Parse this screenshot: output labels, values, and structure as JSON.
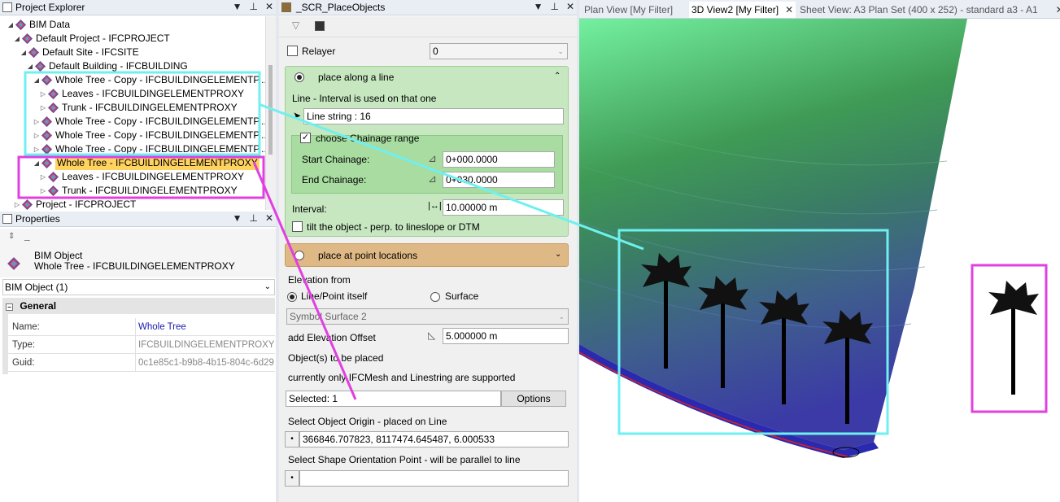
{
  "explorer": {
    "title": "Project Explorer",
    "tree": [
      {
        "label": "BIM Data",
        "indent": 0,
        "twisty": "expanded"
      },
      {
        "label": "Default Project - IFCPROJECT",
        "indent": 1,
        "twisty": "expanded"
      },
      {
        "label": "Default Site - IFCSITE",
        "indent": 2,
        "twisty": "expanded"
      },
      {
        "label": "Default Building - IFCBUILDING",
        "indent": 3,
        "twisty": "expanded"
      },
      {
        "label": "Whole Tree - Copy - IFCBUILDINGELEMENTP...",
        "indent": 4,
        "twisty": "expanded"
      },
      {
        "label": "Leaves - IFCBUILDINGELEMENTPROXY",
        "indent": 5,
        "twisty": "collapsed"
      },
      {
        "label": "Trunk - IFCBUILDINGELEMENTPROXY",
        "indent": 5,
        "twisty": "collapsed"
      },
      {
        "label": "Whole Tree - Copy - IFCBUILDINGELEMENTP...",
        "indent": 4,
        "twisty": "collapsed"
      },
      {
        "label": "Whole Tree - Copy - IFCBUILDINGELEMENTP...",
        "indent": 4,
        "twisty": "collapsed"
      },
      {
        "label": "Whole Tree - Copy - IFCBUILDINGELEMENTP...",
        "indent": 4,
        "twisty": "collapsed"
      },
      {
        "label": "Whole Tree - IFCBUILDINGELEMENTPROXY",
        "indent": 4,
        "twisty": "expanded",
        "selected": true
      },
      {
        "label": "Leaves - IFCBUILDINGELEMENTPROXY",
        "indent": 5,
        "twisty": "collapsed"
      },
      {
        "label": "Trunk - IFCBUILDINGELEMENTPROXY",
        "indent": 5,
        "twisty": "collapsed"
      },
      {
        "label": "Project - IFCPROJECT",
        "indent": 1,
        "twisty": "collapsed"
      }
    ]
  },
  "properties": {
    "title": "Properties",
    "object_type": "BIM Object",
    "object_name": "Whole Tree - IFCBUILDINGELEMENTPROXY",
    "selector": "BIM Object (1)",
    "section": "General",
    "rows": [
      {
        "key": "Name:",
        "value": "Whole Tree"
      },
      {
        "key": "Type:",
        "value": "IFCBUILDINGELEMENTPROXY"
      },
      {
        "key": "Guid:",
        "value": "0c1e85c1-b9b8-4b15-804c-6d29"
      }
    ]
  },
  "place_objects": {
    "title": "_SCR_PlaceObjects",
    "relayer_label": "Relayer",
    "relayer_value": "0",
    "line_section_title": "place along a line",
    "line_hint": "Line - Interval is used on that one",
    "line_value": "Line string : 16",
    "chainage_label": "choose Chainage range",
    "start_label": "Start Chainage:",
    "start_value": "0+000.0000",
    "end_label": "End Chainage:",
    "end_value": "0+030.0000",
    "interval_label": "Interval:",
    "interval_value": "10.00000 m",
    "tilt_label": "tilt the object - perp. to lineslope or DTM",
    "point_section_title": "place at point locations",
    "elevation_label": "Elevation from",
    "elev_opt1": "Line/Point itself",
    "elev_opt2": "Surface",
    "surface_value": "Symbol Surface 2",
    "offset_label": "add Elevation Offset",
    "offset_value": "5.000000 m",
    "objects_label": "Object(s) to be placed",
    "supported_label": "currently only IFCMesh and Linestring are supported",
    "selected_value": "Selected: 1",
    "options_button": "Options",
    "origin_label": "Select Object Origin - placed on Line",
    "origin_value": "366846.707823, 8117474.645487, 6.000533",
    "orient_label": "Select Shape Orientation Point - will be parallel to line",
    "orient_value": ""
  },
  "tabs": [
    {
      "label": "Plan View [My Filter]",
      "active": false
    },
    {
      "label": "3D View2 [My Filter]",
      "active": true
    },
    {
      "label": "Sheet View: A3 Plan Set (400 x 252) - standard a3 - A1",
      "active": false
    }
  ],
  "colors": {
    "highlight_cyan": "#6ff0f0",
    "highlight_magenta": "#e040e0",
    "line_section_green": "#c6e7c0",
    "point_section_orange": "#dfb985",
    "selection_yellow": "#ffd35f"
  }
}
